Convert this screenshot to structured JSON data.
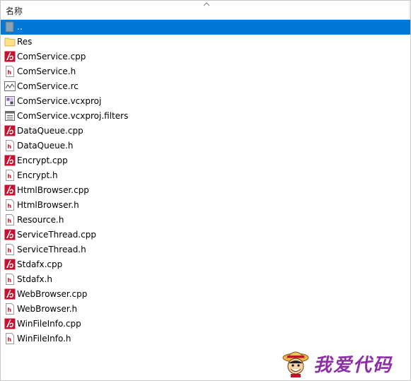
{
  "header": {
    "column_name": "名称",
    "sort_icon": "chevron-up-icon"
  },
  "colors": {
    "selection": "#0078d7",
    "cpp_icon": "#c8102e",
    "folder": "#ffe08a",
    "watermark": "#8d2fa6"
  },
  "files": [
    {
      "name": "..",
      "icon": "parent-folder-icon",
      "selected": true
    },
    {
      "name": "Res",
      "icon": "folder-icon"
    },
    {
      "name": "ComService.cpp",
      "icon": "cpp-file-icon"
    },
    {
      "name": "ComService.h",
      "icon": "header-file-icon"
    },
    {
      "name": "ComService.rc",
      "icon": "resource-file-icon"
    },
    {
      "name": "ComService.vcxproj",
      "icon": "vcxproj-file-icon"
    },
    {
      "name": "ComService.vcxproj.filters",
      "icon": "filters-file-icon"
    },
    {
      "name": "DataQueue.cpp",
      "icon": "cpp-file-icon"
    },
    {
      "name": "DataQueue.h",
      "icon": "header-file-icon"
    },
    {
      "name": "Encrypt.cpp",
      "icon": "cpp-file-icon"
    },
    {
      "name": "Encrypt.h",
      "icon": "header-file-icon"
    },
    {
      "name": "HtmlBrowser.cpp",
      "icon": "cpp-file-icon"
    },
    {
      "name": "HtmlBrowser.h",
      "icon": "header-file-icon"
    },
    {
      "name": "Resource.h",
      "icon": "header-file-icon"
    },
    {
      "name": "ServiceThread.cpp",
      "icon": "cpp-file-icon"
    },
    {
      "name": "ServiceThread.h",
      "icon": "header-file-icon"
    },
    {
      "name": "Stdafx.cpp",
      "icon": "cpp-file-icon"
    },
    {
      "name": "Stdafx.h",
      "icon": "header-file-icon"
    },
    {
      "name": "WebBrowser.cpp",
      "icon": "cpp-file-icon"
    },
    {
      "name": "WebBrowser.h",
      "icon": "header-file-icon"
    },
    {
      "name": "WinFileInfo.cpp",
      "icon": "cpp-file-icon"
    },
    {
      "name": "WinFileInfo.h",
      "icon": "header-file-icon"
    }
  ],
  "watermark": {
    "text": "我爱代码",
    "icon": "mascot-logo-icon"
  }
}
